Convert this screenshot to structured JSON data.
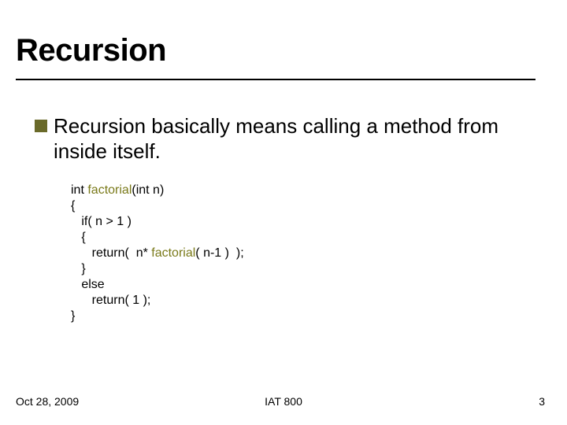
{
  "title": "Recursion",
  "bullet": "Recursion basically means calling a method from inside itself.",
  "code": {
    "l1a": "int ",
    "l1b": "factorial",
    "l1c": "(int n)",
    "l2": "{",
    "l3": "   if( n > 1 )",
    "l4": "   {",
    "l5a": "      return(  n* ",
    "l5b": "factorial",
    "l5c": "( n-1 )  );",
    "l6": "   }",
    "l7": "   else",
    "l8": "      return( 1 );",
    "l9": "}"
  },
  "footer": {
    "date": "Oct 28, 2009",
    "center": "IAT 800",
    "page": "3"
  }
}
